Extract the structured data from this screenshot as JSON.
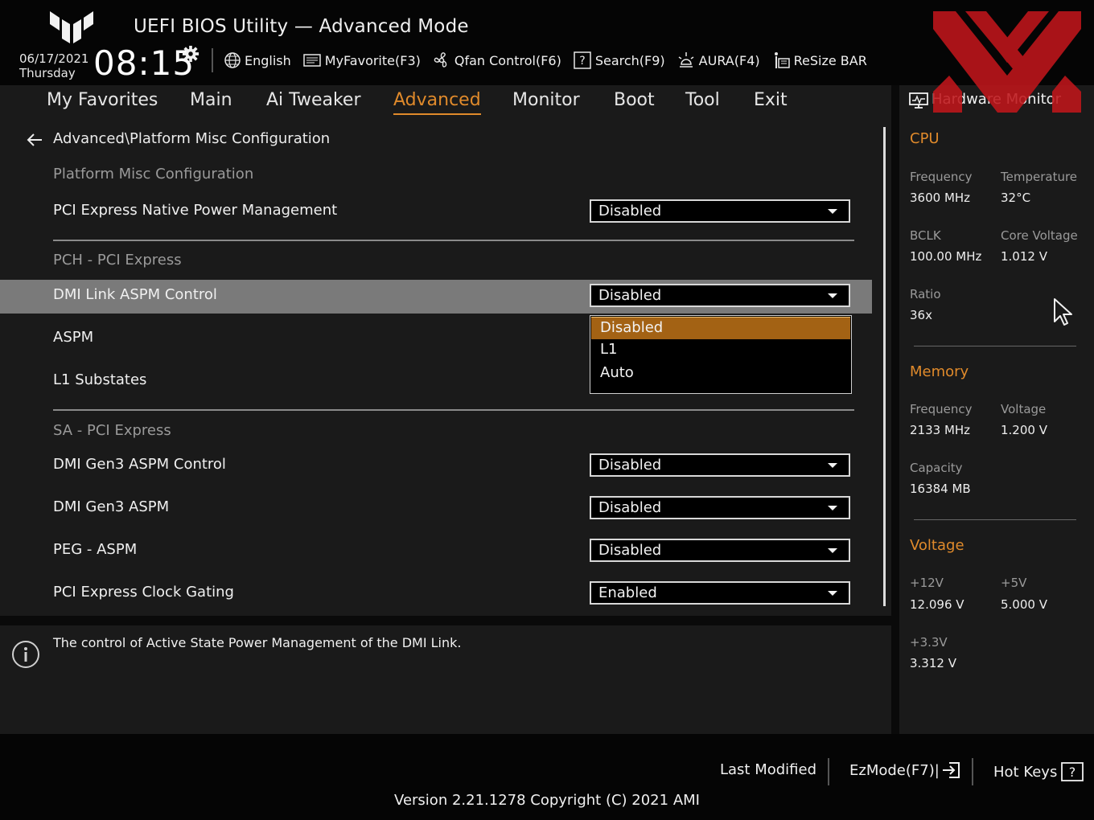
{
  "header": {
    "title": "UEFI BIOS Utility — Advanced Mode",
    "date": "06/17/2021",
    "weekday": "Thursday",
    "time": "08:15",
    "toolbar": [
      {
        "label": "English",
        "icon": "globe-icon"
      },
      {
        "label": "MyFavorite(F3)",
        "icon": "favorite-icon"
      },
      {
        "label": "Qfan Control(F6)",
        "icon": "fan-icon"
      },
      {
        "label": "Search(F9)",
        "icon": "search-help-icon"
      },
      {
        "label": "AURA(F4)",
        "icon": "aura-light-icon"
      },
      {
        "label": "ReSize BAR",
        "icon": "resize-bar-icon"
      }
    ]
  },
  "nav": {
    "tabs": [
      "My Favorites",
      "Main",
      "Ai Tweaker",
      "Advanced",
      "Monitor",
      "Boot",
      "Tool",
      "Exit"
    ],
    "active": "Advanced"
  },
  "main": {
    "breadcrumb": "Advanced\\Platform Misc Configuration",
    "section1": "Platform Misc Configuration",
    "pci_native_pm": {
      "label": "PCI Express Native Power Management",
      "value": "Disabled"
    },
    "section2": "PCH - PCI Express",
    "dmi_link_aspm": {
      "label": "DMI Link ASPM Control",
      "value": "Disabled"
    },
    "aspm": {
      "label": "ASPM"
    },
    "l1_substates": {
      "label": "L1 Substates"
    },
    "dropdown_options": [
      "Disabled",
      "L1",
      "Auto"
    ],
    "section3": "SA - PCI Express",
    "dmi_gen3_aspm_control": {
      "label": "DMI Gen3 ASPM Control",
      "value": "Disabled"
    },
    "dmi_gen3_aspm": {
      "label": "DMI Gen3 ASPM",
      "value": "Disabled"
    },
    "peg_aspm": {
      "label": "PEG - ASPM",
      "value": "Disabled"
    },
    "clock_gating": {
      "label": "PCI Express Clock Gating",
      "value": "Enabled"
    }
  },
  "help": {
    "text": "The control of Active State Power Management of the DMI Link."
  },
  "hw_monitor": {
    "title": "Hardware Monitor",
    "cpu": {
      "title": "CPU",
      "frequency_label": "Frequency",
      "frequency": "3600 MHz",
      "temperature_label": "Temperature",
      "temperature": "32°C",
      "bclk_label": "BCLK",
      "bclk": "100.00 MHz",
      "core_voltage_label": "Core Voltage",
      "core_voltage": "1.012 V",
      "ratio_label": "Ratio",
      "ratio": "36x"
    },
    "memory": {
      "title": "Memory",
      "frequency_label": "Frequency",
      "frequency": "2133 MHz",
      "voltage_label": "Voltage",
      "voltage": "1.200 V",
      "capacity_label": "Capacity",
      "capacity": "16384 MB"
    },
    "voltage": {
      "title": "Voltage",
      "v12_label": "+12V",
      "v12": "12.096 V",
      "v5_label": "+5V",
      "v5": "5.000 V",
      "v33_label": "+3.3V",
      "v33": "3.312 V"
    }
  },
  "footer": {
    "last_modified": "Last Modified",
    "ezmode": "EzMode(F7)|",
    "hotkeys": "Hot Keys",
    "hotkeys_glyph": "?",
    "version": "Version 2.21.1278 Copyright (C) 2021 AMI"
  },
  "colors": {
    "accent": "#e08a2b",
    "selected_option": "#a36214",
    "highlight_row": "#7a7a7a",
    "panel": "#1a1a1a",
    "watermark": "#c0161b"
  }
}
